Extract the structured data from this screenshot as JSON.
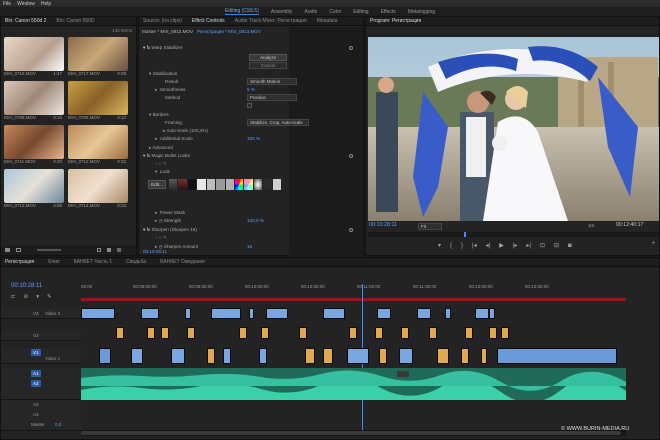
{
  "menu": [
    "File",
    "Window",
    "Help"
  ],
  "workspaces": [
    {
      "label": "Editing (CS6.5)",
      "active": true
    },
    {
      "label": "Assembly"
    },
    {
      "label": "Audio"
    },
    {
      "label": "Color"
    },
    {
      "label": "Editing"
    },
    {
      "label": "Effects"
    },
    {
      "label": "Metalogging"
    }
  ],
  "project": {
    "tabs": [
      "Bin: Canon 550d 2",
      "Bin: Canon 550D"
    ],
    "info_left": "",
    "info_right": "146 Items",
    "items": [
      "MVI_0716.MOV",
      "MVI_0717.MOV",
      "MVI_0708.MOV",
      "MVI_0706.MOV",
      "MVI_0711.MOV",
      "MVI_0712.MOV",
      "MVI_0713.MOV",
      "MVI_0714.MOV"
    ]
  },
  "effect_controls": {
    "tabs": [
      "Source: (no clips)",
      "Effect Controls",
      "Audio Track Mixer: Регистрация",
      "Metadata"
    ],
    "header_left": "Master * MVI_0813.MOV",
    "header_right": "Регистрация * MVI_0813.MOV",
    "effect1": "Warp Stabilizer",
    "analyze": "Analyze",
    "cancel": "Cancel",
    "stabilization": "Stabilization",
    "result_label": "Result",
    "result_value": "Smooth Motion",
    "smoothness_label": "Smoothness",
    "smoothness_value": "5 %",
    "method_label": "Method",
    "method_value": "Position",
    "borders": "Borders",
    "framing_label": "Framing",
    "framing_value": "Stabilize, Crop, Auto-scale",
    "autoscale_label": "Auto-scale (100,4%)",
    "additional_label": "Additional Scale",
    "additional_value": "100 %",
    "advanced": "Advanced",
    "effect2": "Magic Bullet Looks",
    "look_label": "Look",
    "edit_btn": "Edit...",
    "power_mask": "Power Mask",
    "strength_label": "Strength",
    "strength_value": "100,0 %",
    "effect3": "Sharpen (Sharpen 15)",
    "sharpen_amount_label": "Sharpen Amount",
    "sharpen_amount_value": "15",
    "timecode": "00:10:28:11"
  },
  "program": {
    "title": "Program: Регистрация",
    "timecode": "00:10:28:11",
    "fit": "Fit",
    "page": "1/2",
    "duration": "00:12:40:17"
  },
  "timeline": {
    "tabs": [
      "Регистрация",
      "Клип",
      "БАНКЕТ Часть 1",
      "Свадьба",
      "БАНКЕТ Ожидание"
    ],
    "timecode": "00:10:28:11",
    "ruler": [
      "00:00",
      "00:09:00:00",
      "00:09:30:00",
      "00:10:00:00",
      "00:10:30:00",
      "00:11:00:00",
      "00:11:30:00",
      "00:12:00:00",
      "00:12:30:00"
    ],
    "tracks": [
      {
        "id": "V3",
        "name": "Video 3"
      },
      {
        "id": "V2",
        "name": ""
      },
      {
        "id": "V1",
        "name": "Video 1"
      },
      {
        "id": "A1",
        "name": ""
      },
      {
        "id": "A2",
        "name": ""
      },
      {
        "id": "A3",
        "name": ""
      },
      {
        "id": "A4",
        "name": ""
      }
    ],
    "master_label": "Master",
    "master_value": "0,0"
  },
  "watermark": "© WWW.BURIN-MEDIA.RU",
  "colors": {
    "accent": "#3d8bff",
    "audio": "#36c8a0",
    "video_clip": "#7ba7e0",
    "orange_clip": "#e0a850"
  }
}
